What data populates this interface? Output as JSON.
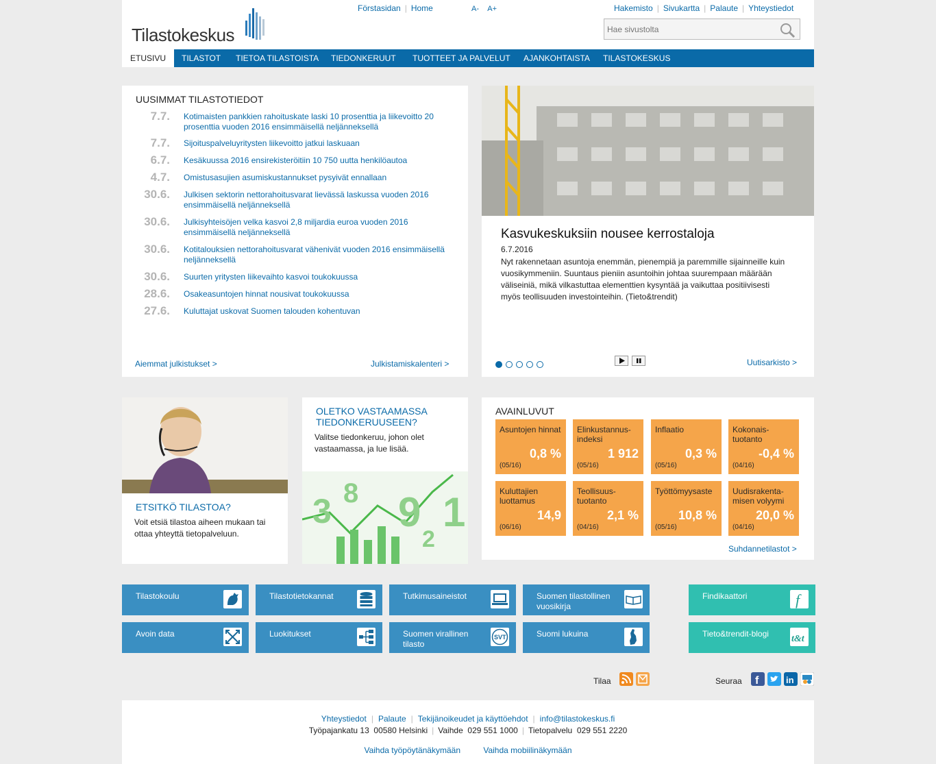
{
  "header": {
    "logo": "Tilastokeskus",
    "top_left_links": [
      "Förstasidan",
      "Home"
    ],
    "font_small": "A-",
    "font_large": "A+",
    "top_right_links": [
      "Hakemisto",
      "Sivukartta",
      "Palaute",
      "Yhteystiedot"
    ],
    "search_placeholder": "Hae sivustolta"
  },
  "nav": [
    "ETUSIVU",
    "TILASTOT",
    "TIETOA TILASTOISTA",
    "TIEDONKERUUT",
    "TUOTTEET JA PALVELUT",
    "AJANKOHTAISTA",
    "TILASTOKESKUS"
  ],
  "news": {
    "title": "UUSIMMAT TILASTOTIEDOT",
    "items": [
      {
        "date": "7.7.",
        "text": "Kotimaisten pankkien rahoituskate laski 10 prosenttia ja liikevoitto 20 prosenttia vuoden 2016 ensimmäisellä neljänneksellä"
      },
      {
        "date": "7.7.",
        "text": "Sijoituspalveluyritysten liikevoitto jatkui laskuaan"
      },
      {
        "date": "6.7.",
        "text": "Kesäkuussa 2016 ensirekisteröitiin 10 750 uutta henkilöautoa"
      },
      {
        "date": "4.7.",
        "text": "Omistusasujien asumiskustannukset pysyivät ennallaan"
      },
      {
        "date": "30.6.",
        "text": "Julkisen sektorin nettorahoitusvarat lievässä laskussa vuoden 2016 ensimmäisellä neljänneksellä"
      },
      {
        "date": "30.6.",
        "text": "Julkisyhteisöjen velka kasvoi 2,8 miljardia euroa vuoden 2016 ensimmäisellä neljänneksellä"
      },
      {
        "date": "30.6.",
        "text": "Kotitalouksien nettorahoitusvarat vähenivät vuoden 2016 ensimmäisellä neljänneksellä"
      },
      {
        "date": "30.6.",
        "text": "Suurten yritysten liikevaihto kasvoi toukokuussa"
      },
      {
        "date": "28.6.",
        "text": "Osakeasuntojen hinnat nousivat toukokuussa"
      },
      {
        "date": "27.6.",
        "text": "Kuluttajat uskovat Suomen talouden kohentuvan"
      }
    ],
    "prev_link": "Aiemmat julkistukset >",
    "calendar_link": "Julkistamiskalenteri >"
  },
  "feature": {
    "title": "Kasvukeskuksiin nousee kerrostaloja",
    "date": "6.7.2016",
    "text": "Nyt rakennetaan asuntoja enemmän, pienempiä ja paremmille sijainneille kuin vuosikymmeniin. Suuntaus pieniin asuntoihin johtaa suurempaan määrään väliseiniä, mikä vilkastuttaa elementtien kysyntää ja vaikuttaa positiivisesti myös teollisuuden investointeihin. (Tieto&trendit)",
    "archive_link": "Uutisarkisto >"
  },
  "etsitko": {
    "title": "ETSITKÖ TILASTOA?",
    "text": "Voit etsiä tilastoa aiheen mukaan tai ottaa yhteyttä tietopalveluun."
  },
  "oletko": {
    "title": "OLETKO VASTAAMASSA TIEDONKERUUSEEN?",
    "text": "Valitse tiedonkeruu, johon olet vastaamassa, ja lue lisää."
  },
  "key": {
    "title": "AVAINLUVUT",
    "items": [
      {
        "name": "Asuntojen hinnat",
        "value": "0,8 %",
        "period": "(05/16)"
      },
      {
        "name": "Elinkustannus-indeksi",
        "value": "1 912",
        "period": "(05/16)"
      },
      {
        "name": "Inflaatio",
        "value": "0,3 %",
        "period": "(05/16)"
      },
      {
        "name": "Kokonais-tuotanto",
        "value": "-0,4 %",
        "period": "(04/16)"
      },
      {
        "name": "Kuluttajien luottamus",
        "value": "14,9",
        "period": "(06/16)"
      },
      {
        "name": "Teollisuus-tuotanto",
        "value": "2,1 %",
        "period": "(04/16)"
      },
      {
        "name": "Työttömyysaste",
        "value": "10,8 %",
        "period": "(05/16)"
      },
      {
        "name": "Uudisrakenta-misen volyymi",
        "value": "20,0 %",
        "period": "(04/16)"
      }
    ],
    "link": "Suhdannetilastot >"
  },
  "tiles": [
    {
      "label": "Tilastokoulu",
      "icon": "rooster-icon"
    },
    {
      "label": "Tilastotietokannat",
      "icon": "database-icon"
    },
    {
      "label": "Tutkimusaineistot",
      "icon": "laptop-icon"
    },
    {
      "label": "Suomen tilastollinen vuosikirja",
      "icon": "book-icon"
    },
    {
      "label": "Findikaattori",
      "icon": "f-icon"
    },
    {
      "label": "Avoin data",
      "icon": "expand-icon"
    },
    {
      "label": "Luokitukset",
      "icon": "tree-icon"
    },
    {
      "label": "Suomen virallinen tilasto",
      "icon": "svt-icon"
    },
    {
      "label": "Suomi lukuina",
      "icon": "finland-map-icon"
    },
    {
      "label": "Tieto&trendit-blogi",
      "icon": "tt-icon"
    }
  ],
  "follow": {
    "tilaa": "Tilaa",
    "seuraa": "Seuraa"
  },
  "footer": {
    "links": [
      "Yhteystiedot",
      "Palaute",
      "Tekijänoikeudet ja käyttöehdot",
      "info@tilastokeskus.fi"
    ],
    "address": "Työpajankatu 13  00580 Helsinki",
    "vaihde": "Vaihde  029 551 1000",
    "tietopalvelu": "Tietopalvelu  029 551 2220",
    "desktop": "Vaihda työpöytänäkymään",
    "mobile": "Vaihda mobiilinäkymään"
  },
  "colors": {
    "accent": "#0a6aa8",
    "orange": "#f5a54a",
    "tile_blue": "#3a8fc2",
    "tile_teal": "#30bfb0"
  }
}
